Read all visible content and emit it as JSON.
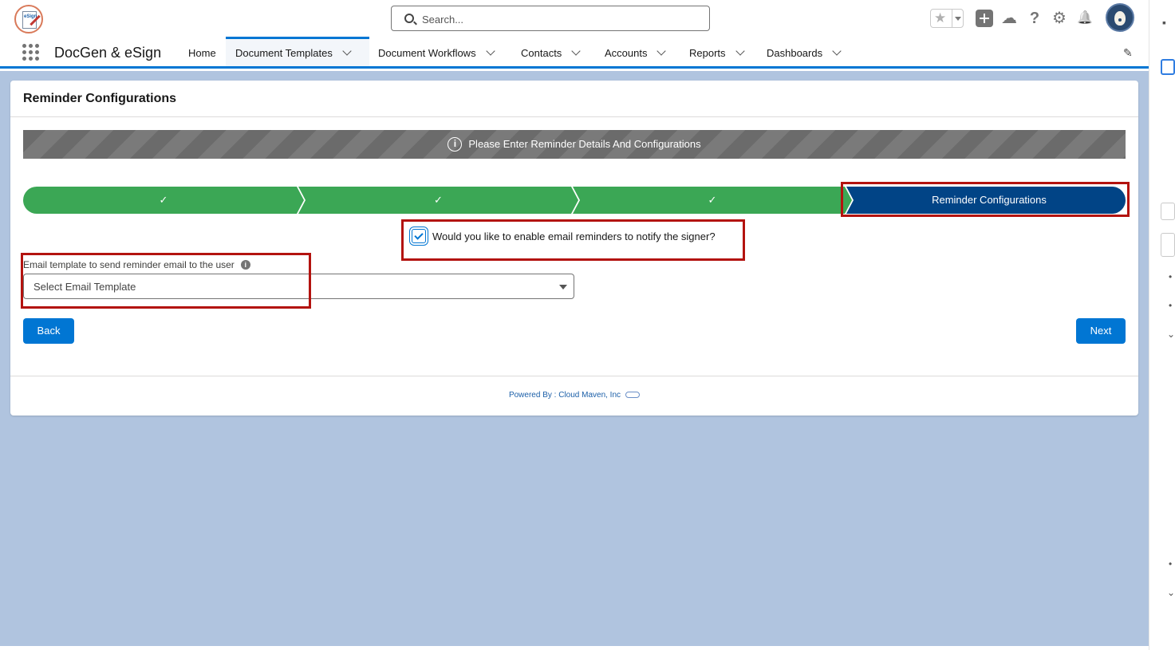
{
  "header": {
    "search_placeholder": "Search...",
    "star": "★",
    "help": "?",
    "gear": "⚙",
    "bell": "🔔",
    "trail": "☁"
  },
  "app": {
    "logo_text": "eSign",
    "name": "DocGen & eSign"
  },
  "nav": {
    "items": [
      {
        "label": "Home"
      },
      {
        "label": "Document Templates"
      },
      {
        "label": "Document Workflows"
      },
      {
        "label": "Contacts"
      },
      {
        "label": "Accounts"
      },
      {
        "label": "Reports"
      },
      {
        "label": "Dashboards"
      }
    ],
    "active": "Document Templates",
    "edit": "✎"
  },
  "card": {
    "title": "Reminder Configurations",
    "banner": {
      "icon": "i",
      "text": "Please Enter Reminder Details And Configurations"
    },
    "path": {
      "steps": [
        {
          "label": "✓",
          "status": "complete"
        },
        {
          "label": "✓",
          "status": "complete"
        },
        {
          "label": "✓",
          "status": "complete"
        },
        {
          "label": "Reminder Configurations",
          "status": "current"
        }
      ]
    },
    "reminder_checkbox": {
      "label": "Would you like to enable email reminders to notify the signer?",
      "checked": true
    },
    "email_template": {
      "label": "Email template to send reminder email to the user",
      "help": "i",
      "placeholder": "Select Email Template"
    },
    "back_label": "Back",
    "next_label": "Next",
    "powered_by": "Powered By : Cloud Maven, Inc"
  },
  "colors": {
    "brand": "#0176d3",
    "complete": "#3ba755",
    "current": "#014486",
    "highlight": "#b3130f",
    "page_bg": "#b0c4df"
  }
}
